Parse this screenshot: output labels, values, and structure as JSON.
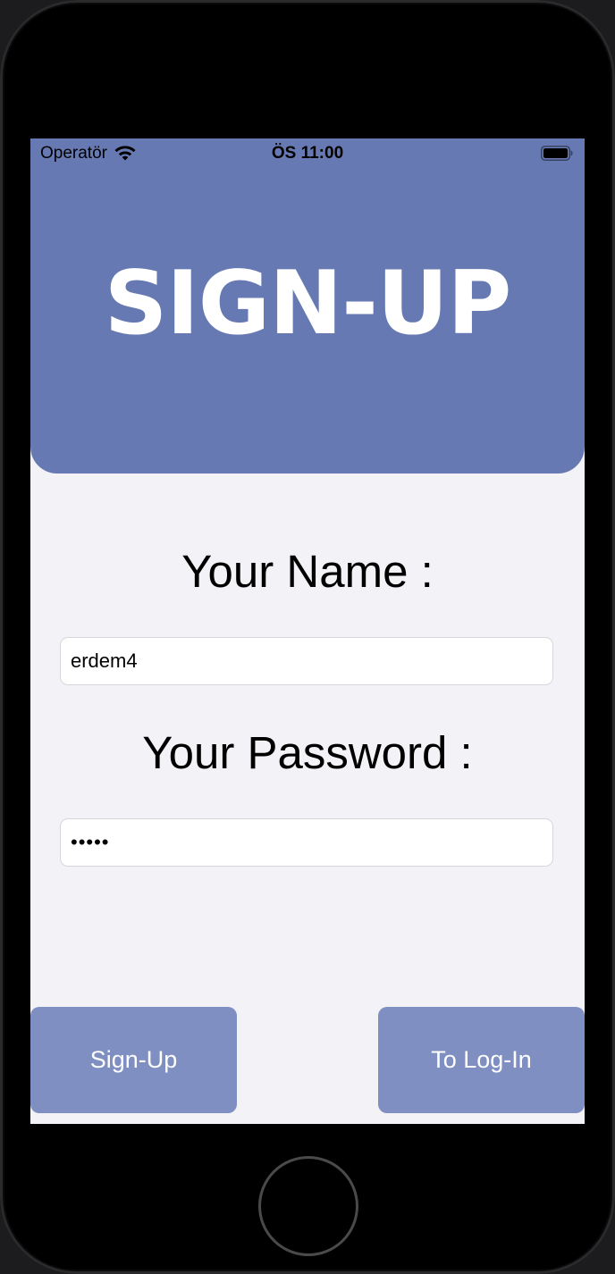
{
  "status_bar": {
    "carrier": "Operatör",
    "time": "ÖS 11:00",
    "wifi_icon": "wifi-icon",
    "battery_icon": "battery-icon"
  },
  "header": {
    "title": "SIGN-UP",
    "color": "#6779b2"
  },
  "form": {
    "name_label": "Your Name :",
    "name_value": "erdem4",
    "password_label": "Your Password :",
    "password_masked": "•••••"
  },
  "buttons": {
    "signup_label": "Sign-Up",
    "login_label": "To Log-In",
    "color": "#7f8fc1"
  },
  "colors": {
    "screen_background": "#f2f2f7",
    "text_on_accent": "#ffffff"
  }
}
